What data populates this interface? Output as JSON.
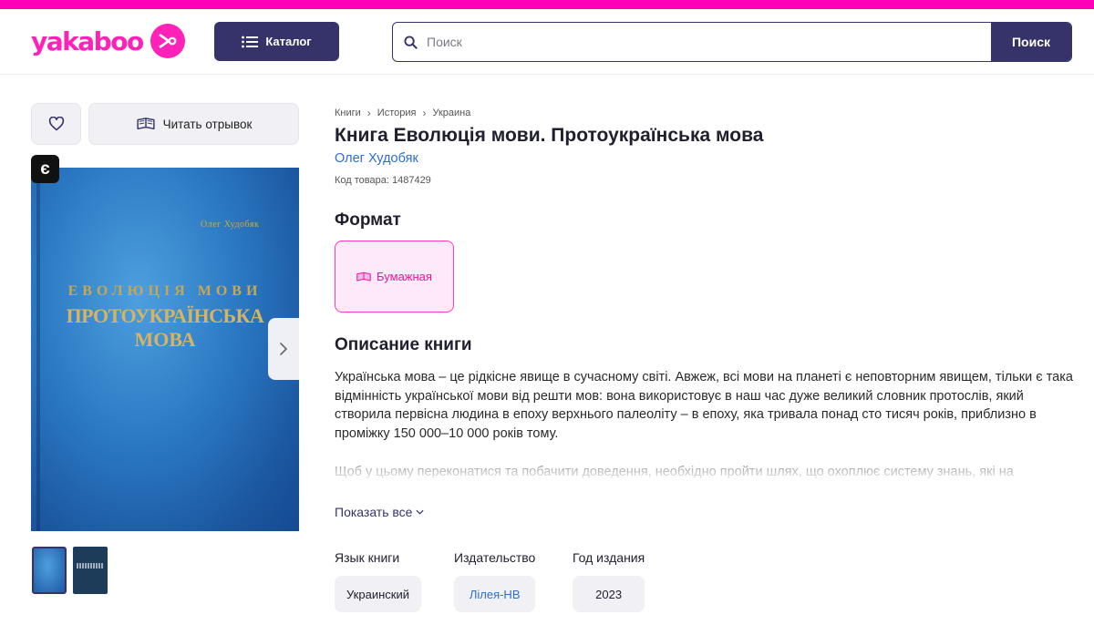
{
  "header": {
    "logo_text": "yakaboo",
    "catalog_label": "Каталог",
    "search_placeholder": "Поиск",
    "search_button": "Поиск",
    "brand_color": "#ff22b8",
    "accent_color": "#35336a"
  },
  "gallery": {
    "read_excerpt_label": "Читать отрывок",
    "e_badge": "є",
    "cover": {
      "author": "Олег Худобяк",
      "title_line1": "ЕВОЛЮЦІЯ МОВИ",
      "title_line2": "ПРОТОУКРАЇНСЬКА",
      "title_line3": "МОВА"
    }
  },
  "product": {
    "breadcrumbs": [
      "Книги",
      "История",
      "Украина"
    ],
    "title_prefix": "Книга ",
    "title": "Еволюція мови. Протоукраїнська мова",
    "author": "Олег Худобяк",
    "code": "Код товара: 1487429"
  },
  "format": {
    "heading": "Формат",
    "selected": "Бумажная"
  },
  "description": {
    "heading": "Описание книги",
    "paragraph1": "Українська мова – це рідкісне явище в сучасному світі. Авжеж, всі мови на планеті є неповторним явищем, тільки є така відмінність української мови від решти мов: вона використовує в наш час дуже великий словник протослів, який створила первісна людина в епоху верхнього палеоліту – в епоху, яка тривала понад сто тисяч років, приблизно в проміжку 150 000–10 000 років тому.",
    "paragraph2": "Щоб у цьому переконатися та побачити доведення, необхідно пройти шлях, що охоплює систему знань, які на",
    "show_all": "Показать все"
  },
  "attributes": {
    "language_label": "Язык книги",
    "language_value": "Украинский",
    "publisher_label": "Издательство",
    "publisher_value": "Лілея-НВ",
    "year_label": "Год издания",
    "year_value": "2023"
  }
}
